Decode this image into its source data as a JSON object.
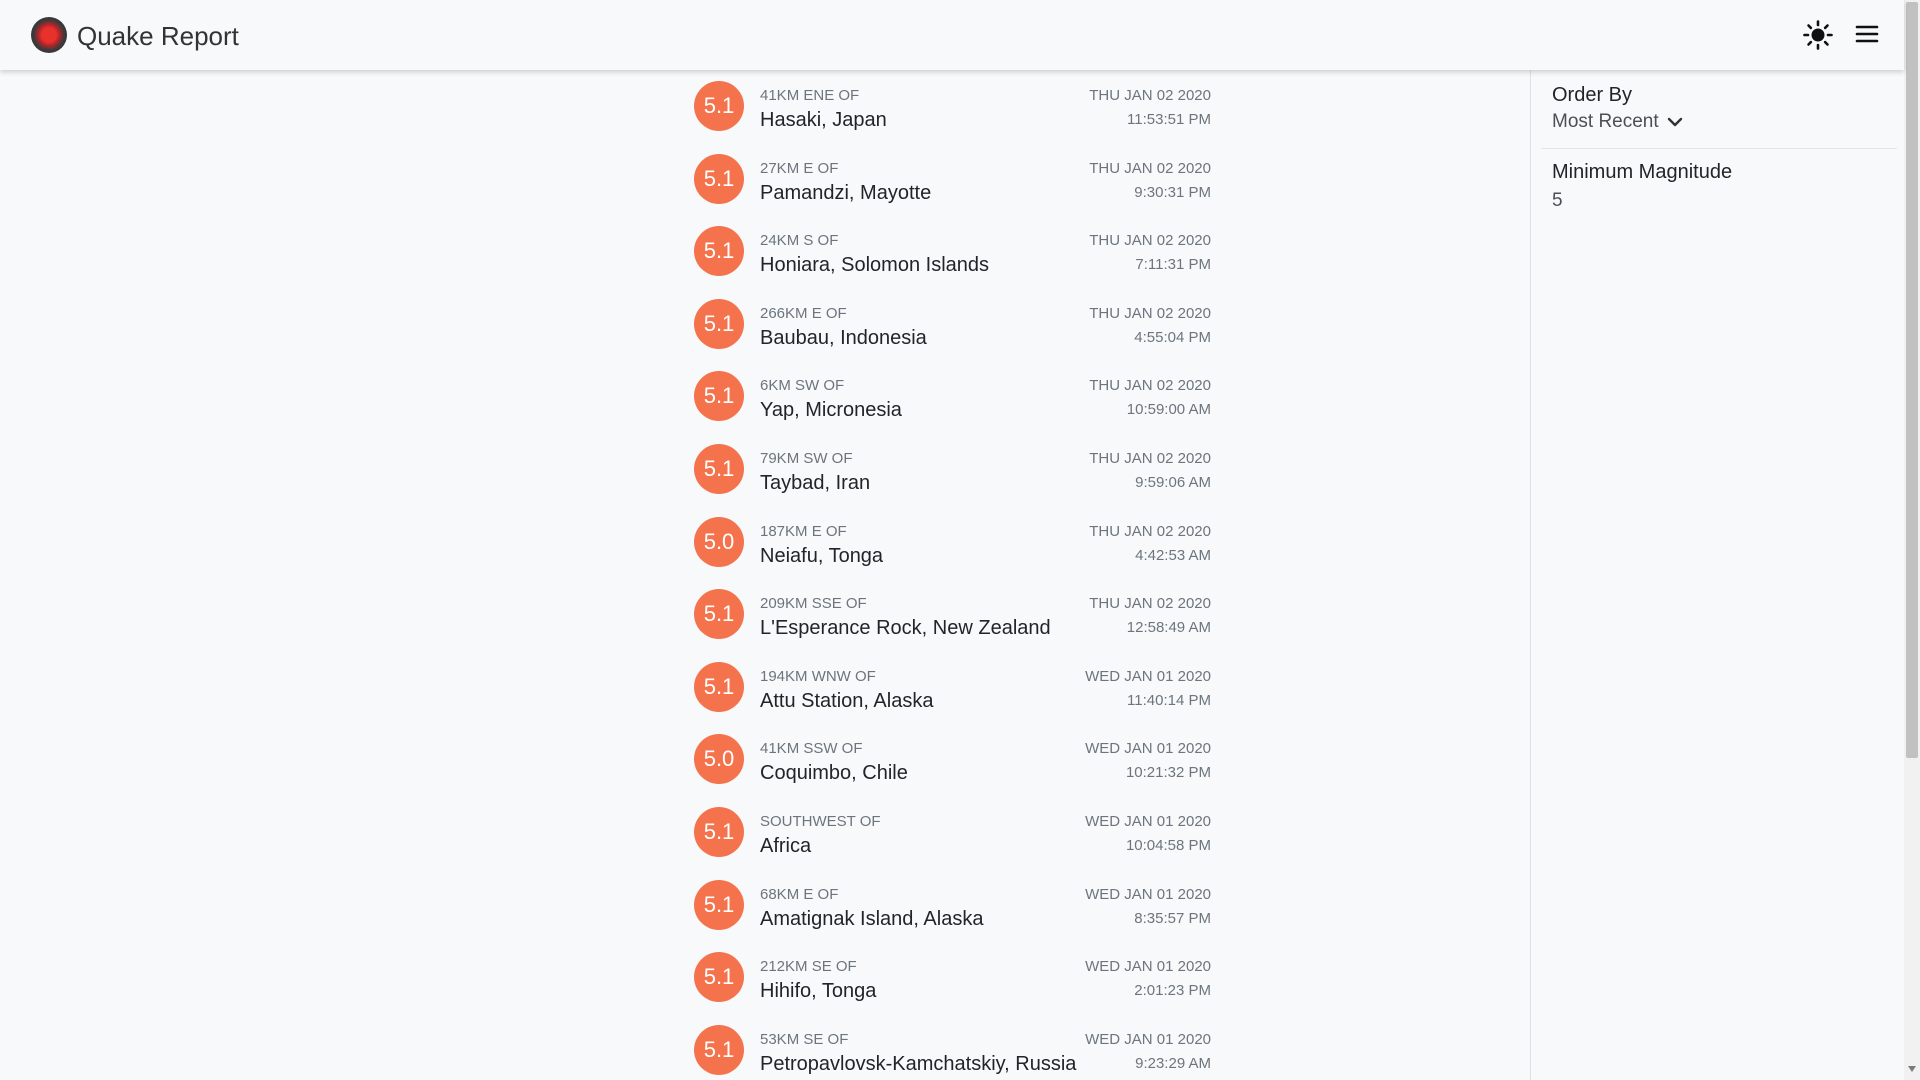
{
  "header": {
    "title": "Quake Report",
    "icons": {
      "logo": "quake-logo",
      "theme": "sun-icon",
      "menu": "hamburger-menu-icon"
    }
  },
  "colors": {
    "magnitude_badge": "#f4734d",
    "header_bg": "#f8f9fa",
    "muted_text": "#6c757d"
  },
  "quakes": [
    {
      "mag": "5.1",
      "offset": "41km ENE of",
      "place": "Hasaki, Japan",
      "date": "THU JAN 02 2020",
      "time": "11:53:51 PM"
    },
    {
      "mag": "5.1",
      "offset": "27km E of",
      "place": "Pamandzi, Mayotte",
      "date": "THU JAN 02 2020",
      "time": "9:30:31 PM"
    },
    {
      "mag": "5.1",
      "offset": "24km S of",
      "place": "Honiara, Solomon Islands",
      "date": "THU JAN 02 2020",
      "time": "7:11:31 PM"
    },
    {
      "mag": "5.1",
      "offset": "266km E of",
      "place": "Baubau, Indonesia",
      "date": "THU JAN 02 2020",
      "time": "4:55:04 PM"
    },
    {
      "mag": "5.1",
      "offset": "6km SW of",
      "place": "Yap, Micronesia",
      "date": "THU JAN 02 2020",
      "time": "10:59:00 AM"
    },
    {
      "mag": "5.1",
      "offset": "79km SW of",
      "place": "Taybad, Iran",
      "date": "THU JAN 02 2020",
      "time": "9:59:06 AM"
    },
    {
      "mag": "5.0",
      "offset": "187km E of",
      "place": "Neiafu, Tonga",
      "date": "THU JAN 02 2020",
      "time": "4:42:53 AM"
    },
    {
      "mag": "5.1",
      "offset": "209km SSE of",
      "place": "L'Esperance Rock, New Zealand",
      "date": "THU JAN 02 2020",
      "time": "12:58:49 AM"
    },
    {
      "mag": "5.1",
      "offset": "194km WNW of",
      "place": "Attu Station, Alaska",
      "date": "WED JAN 01 2020",
      "time": "11:40:14 PM"
    },
    {
      "mag": "5.0",
      "offset": "41km SSW of",
      "place": "Coquimbo, Chile",
      "date": "WED JAN 01 2020",
      "time": "10:21:32 PM"
    },
    {
      "mag": "5.1",
      "offset": "Southwest of",
      "place": "Africa",
      "date": "WED JAN 01 2020",
      "time": "10:04:58 PM"
    },
    {
      "mag": "5.1",
      "offset": "68km E of",
      "place": "Amatignak Island, Alaska",
      "date": "WED JAN 01 2020",
      "time": "8:35:57 PM"
    },
    {
      "mag": "5.1",
      "offset": "212km SE of",
      "place": "Hihifo, Tonga",
      "date": "WED JAN 01 2020",
      "time": "2:01:23 PM"
    },
    {
      "mag": "5.1",
      "offset": "53km SE of",
      "place": "Petropavlovsk-Kamchatskiy, Russia",
      "date": "WED JAN 01 2020",
      "time": "9:23:29 AM"
    }
  ],
  "sidebar": {
    "order_by_label": "Order By",
    "order_by_value": "Most Recent",
    "min_magnitude_label": "Minimum Magnitude",
    "min_magnitude_value": "5"
  }
}
